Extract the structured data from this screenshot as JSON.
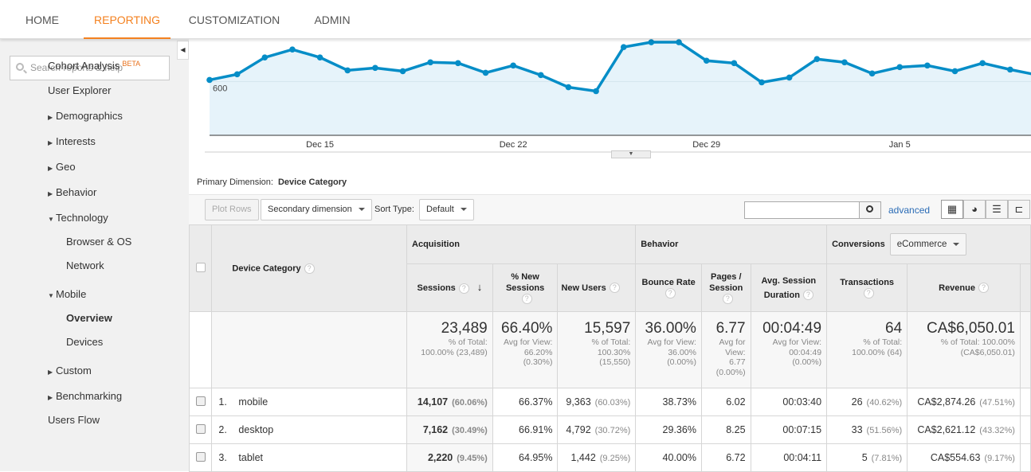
{
  "nav": {
    "tabs": [
      {
        "label": "HOME"
      },
      {
        "label": "REPORTING",
        "active": true
      },
      {
        "label": "CUSTOMIZATION"
      },
      {
        "label": "ADMIN"
      }
    ],
    "accent": "#f4811f"
  },
  "sidebar": {
    "search_placeholder": "Search reports & help",
    "items": [
      {
        "label": "Cohort Analysis",
        "badge": "BETA"
      },
      {
        "label": "User Explorer"
      },
      {
        "label": "Demographics",
        "arrow": "right"
      },
      {
        "label": "Interests",
        "arrow": "right"
      },
      {
        "label": "Geo",
        "arrow": "right"
      },
      {
        "label": "Behavior",
        "arrow": "right"
      },
      {
        "label": "Technology",
        "arrow": "down"
      },
      {
        "label": "Browser & OS"
      },
      {
        "label": "Network"
      },
      {
        "label": "Mobile",
        "arrow": "down"
      },
      {
        "label": "Overview",
        "selected": true
      },
      {
        "label": "Devices"
      },
      {
        "label": "Custom",
        "arrow": "right"
      },
      {
        "label": "Benchmarking",
        "arrow": "right"
      },
      {
        "label": "Users Flow"
      }
    ]
  },
  "chart_data": {
    "type": "area",
    "series_color": "#058dc7",
    "fill_color": "#e6f3fa",
    "y_tick_labels": [
      "600"
    ],
    "x_tick_labels": [
      "Dec 15",
      "Dec 22",
      "Dec 29",
      "Jan 5"
    ],
    "x": [
      "Dec 11",
      "Dec 12",
      "Dec 13",
      "Dec 14",
      "Dec 15",
      "Dec 16",
      "Dec 17",
      "Dec 18",
      "Dec 19",
      "Dec 20",
      "Dec 21",
      "Dec 22",
      "Dec 23",
      "Dec 24",
      "Dec 25",
      "Dec 26",
      "Dec 27",
      "Dec 28",
      "Dec 29",
      "Dec 30",
      "Dec 31",
      "Jan 1",
      "Jan 2",
      "Jan 3",
      "Jan 4",
      "Jan 5",
      "Jan 6",
      "Jan 7",
      "Jan 8",
      "Jan 9",
      "Jan 10"
    ],
    "values": [
      618,
      681,
      869,
      958,
      869,
      725,
      752,
      716,
      815,
      806,
      698,
      779,
      672,
      537,
      493,
      985,
      1039,
      1039,
      833,
      806,
      591,
      645,
      851,
      815,
      690,
      761,
      779,
      716,
      806,
      734,
      672
    ],
    "ylim": [
      0,
      1075
    ]
  },
  "primary_dimension": {
    "label": "Primary Dimension:",
    "value": "Device Category"
  },
  "toolbar": {
    "plot_rows": "Plot Rows",
    "secondary": "Secondary dimension",
    "sort_label": "Sort Type:",
    "sort_value": "Default",
    "advanced": "advanced"
  },
  "table": {
    "groups": {
      "acquisition": "Acquisition",
      "behavior": "Behavior",
      "conversions": "Conversions",
      "conv_select": "eCommerce"
    },
    "headers": {
      "dim": "Device Category",
      "sessions": "Sessions",
      "pct_new": "% New Sessions",
      "new_users": "New Users",
      "bounce": "Bounce Rate",
      "pages": "Pages / Session",
      "duration": "Avg. Session Duration",
      "transactions": "Transactions",
      "revenue": "Revenue"
    },
    "totals": {
      "sessions": {
        "v": "23,489",
        "a": "% of Total:",
        "b": "100.00% (23,489)"
      },
      "pct_new": {
        "v": "66.40%",
        "a": "Avg for View:",
        "b": "66.20%",
        "c": "(0.30%)"
      },
      "new_users": {
        "v": "15,597",
        "a": "% of Total:",
        "b": "100.30%",
        "c": "(15,550)"
      },
      "bounce": {
        "v": "36.00%",
        "a": "Avg for View:",
        "b": "36.00%",
        "c": "(0.00%)"
      },
      "pages": {
        "v": "6.77",
        "a": "Avg for",
        "b": "View:",
        "c": "6.77",
        "d": "(0.00%)"
      },
      "duration": {
        "v": "00:04:49",
        "a": "Avg for View:",
        "b": "00:04:49",
        "c": "(0.00%)"
      },
      "transactions": {
        "v": "64",
        "a": "% of Total:",
        "b": "100.00% (64)"
      },
      "revenue": {
        "v": "CA$6,050.01",
        "a": "% of Total: 100.00%",
        "b": "(CA$6,050.01)"
      }
    },
    "rows": [
      {
        "n": "1.",
        "dev": "mobile",
        "s": "14,107",
        "sp": "(60.06%)",
        "pn": "66.37%",
        "nu": "9,363",
        "nup": "(60.03%)",
        "br": "38.73%",
        "pg": "6.02",
        "d": "00:03:40",
        "t": "26",
        "tp": "(40.62%)",
        "r": "CA$2,874.26",
        "rp": "(47.51%)"
      },
      {
        "n": "2.",
        "dev": "desktop",
        "s": "7,162",
        "sp": "(30.49%)",
        "pn": "66.91%",
        "nu": "4,792",
        "nup": "(30.72%)",
        "br": "29.36%",
        "pg": "8.25",
        "d": "00:07:15",
        "t": "33",
        "tp": "(51.56%)",
        "r": "CA$2,621.12",
        "rp": "(43.32%)"
      },
      {
        "n": "3.",
        "dev": "tablet",
        "s": "2,220",
        "sp": "(9.45%)",
        "pn": "64.95%",
        "nu": "1,442",
        "nup": "(9.25%)",
        "br": "40.00%",
        "pg": "6.72",
        "d": "00:04:11",
        "t": "5",
        "tp": "(7.81%)",
        "r": "CA$554.63",
        "rp": "(9.17%)"
      }
    ]
  }
}
